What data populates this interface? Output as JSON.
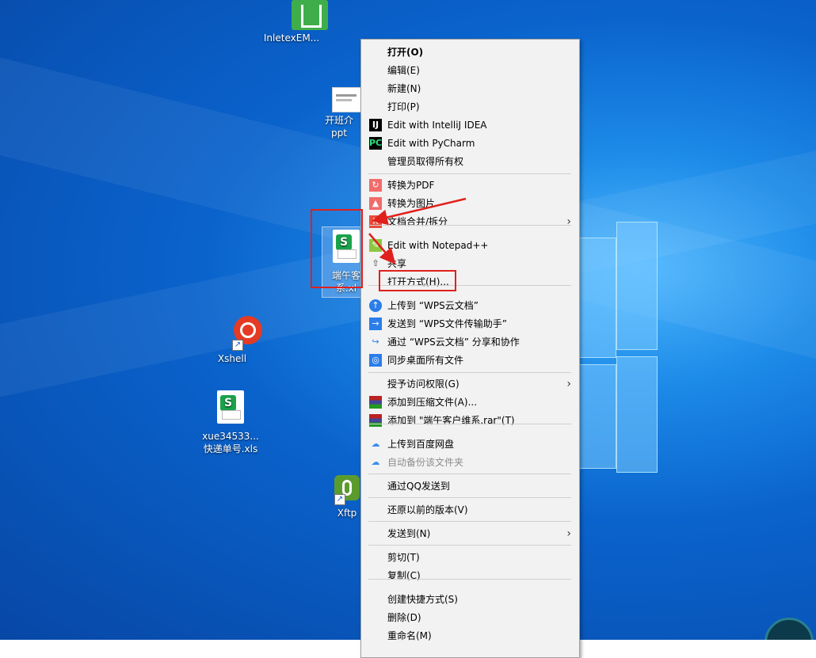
{
  "desktop": {
    "icons": [
      {
        "label": "InletexEM...",
        "kind": "app"
      },
      {
        "label1": "开班介",
        "label2": "ppt",
        "kind": "ppt"
      },
      {
        "label1": "端午客",
        "label2": "系.xl",
        "kind": "xls-selected"
      },
      {
        "label": "Xshell",
        "kind": "xshell"
      },
      {
        "label1": "xue34533...",
        "label2": "快递单号.xls",
        "kind": "xls"
      },
      {
        "label": "Xftp",
        "kind": "xftp"
      }
    ]
  },
  "context_menu": {
    "items": [
      {
        "label": "打开(O)",
        "icon": "",
        "bold": true
      },
      {
        "label": "编辑(E)",
        "icon": ""
      },
      {
        "label": "新建(N)",
        "icon": ""
      },
      {
        "label": "打印(P)",
        "icon": ""
      },
      {
        "label": "Edit with IntelliJ IDEA",
        "icon": "intellij-icon"
      },
      {
        "label": "Edit with PyCharm",
        "icon": "pycharm-icon"
      },
      {
        "label": "管理员取得所有权",
        "icon": ""
      },
      {
        "label": "转换为PDF",
        "icon": "pdf-convert-icon"
      },
      {
        "label": "转换为图片",
        "icon": "image-convert-icon"
      },
      {
        "label": "文档合并/拆分",
        "icon": "merge-split-icon",
        "submenu": true
      },
      {
        "label": "Edit with Notepad++",
        "icon": "notepadpp-icon"
      },
      {
        "label": "共享",
        "icon": "share-icon"
      },
      {
        "label": "打开方式(H)...",
        "icon": "",
        "highlighted": true
      },
      {
        "label": "上传到 “WPS云文档”",
        "icon": "cloud-upload-icon"
      },
      {
        "label": "发送到 “WPS文件传输助手”",
        "icon": "send-folder-icon"
      },
      {
        "label": "通过 “WPS云文档” 分享和协作",
        "icon": "share-arrow-icon"
      },
      {
        "label": "同步桌面所有文件",
        "icon": "sync-icon"
      },
      {
        "label": "授予访问权限(G)",
        "icon": "",
        "submenu": true
      },
      {
        "label": "添加到压缩文件(A)...",
        "icon": "winrar-icon"
      },
      {
        "label": "添加到 \"端午客户维系.rar\"(T)",
        "icon": "winrar-icon"
      },
      {
        "label": "上传到百度网盘",
        "icon": "baidu-cloud-icon"
      },
      {
        "label": "自动备份该文件夹",
        "icon": "baidu-cloud-icon",
        "disabled": true
      },
      {
        "label": "通过QQ发送到",
        "icon": ""
      },
      {
        "label": "还原以前的版本(V)",
        "icon": ""
      },
      {
        "label": "发送到(N)",
        "icon": "",
        "submenu": true
      },
      {
        "label": "剪切(T)",
        "icon": ""
      },
      {
        "label": "复制(C)",
        "icon": ""
      },
      {
        "label": "创建快捷方式(S)",
        "icon": ""
      },
      {
        "label": "删除(D)",
        "icon": ""
      },
      {
        "label": "重命名(M)",
        "icon": ""
      }
    ]
  },
  "colors": {
    "annotation": "#e0201c",
    "menu_bg": "#f2f2f2"
  }
}
